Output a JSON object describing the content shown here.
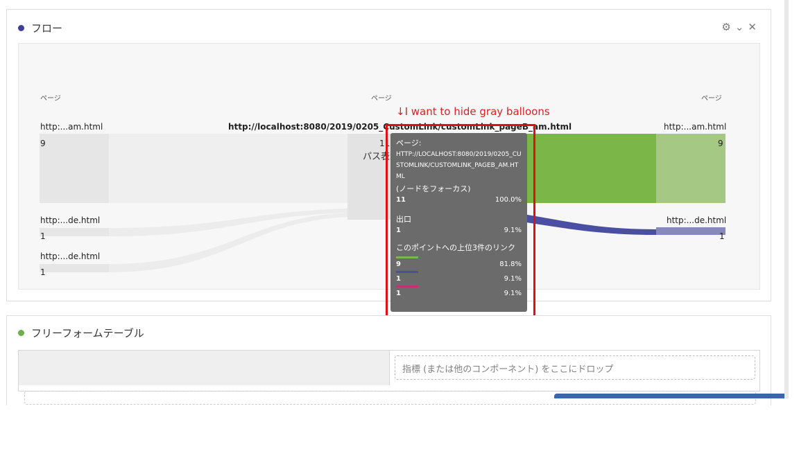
{
  "flow_panel": {
    "title": "フロー",
    "dot_color": "#3d3f99",
    "tools": [
      "settings-icon",
      "chevron-down-icon",
      "close-icon"
    ],
    "tool_glyphs": [
      "⚙",
      "⌄",
      "✕"
    ],
    "columns": [
      {
        "header": "ページ"
      },
      {
        "header": "ページ"
      },
      {
        "header": "ページ"
      }
    ],
    "left_nodes": [
      {
        "label": "http:...am.html",
        "count": "9"
      },
      {
        "label": "http:...de.html",
        "count": "1"
      },
      {
        "label": "http:...de.html",
        "count": "1"
      }
    ],
    "center_node": {
      "label": "http://localhost:8080/2019/0205_CustomLink/customLink_pageB_am.html",
      "count": "11",
      "sublabel": "パス表示"
    },
    "right_nodes": [
      {
        "label": "http:...am.html",
        "count": "9"
      },
      {
        "label": "http:...de.html",
        "count": "1"
      }
    ],
    "colors": {
      "green": "#7ab648",
      "green_light": "#a5c985",
      "blue": "#4b4fa2",
      "blue_light": "#8789bd",
      "gray_node": "#e6e6e6",
      "gray_link": "#ececec"
    }
  },
  "annotation": "↓I want to hide gray balloons",
  "tooltip": {
    "header": "ページ:",
    "url": "HTTP://LOCALHOST:8080/2019/0205_CUSTOMLINK/CUSTOMLINK_PAGEB_AM.HTML",
    "focus": "(ノードをフォーカス)",
    "count": "11",
    "percent": "100.0%",
    "exit_label": "出口",
    "exit_count": "1",
    "exit_percent": "9.1%",
    "top_links_label": "このポイントへの上位3件のリンク",
    "links": [
      {
        "count": "9",
        "percent": "81.8%",
        "color": "#7ab648"
      },
      {
        "count": "1",
        "percent": "9.1%",
        "color": "#4b4fa2"
      },
      {
        "count": "1",
        "percent": "9.1%",
        "color": "#c2307a"
      }
    ]
  },
  "table_panel": {
    "title": "フリーフォームテーブル",
    "dot_color": "#6ab04c",
    "drop_placeholder": "指標 (または他のコンポーネント) をここにドロップ"
  }
}
